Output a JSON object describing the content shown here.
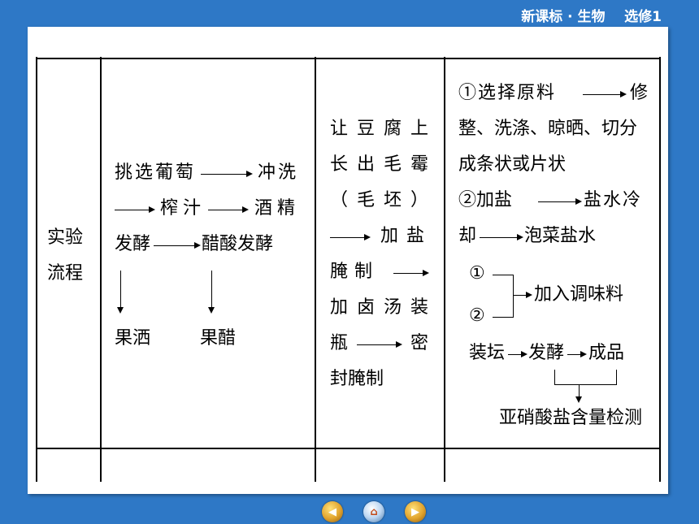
{
  "header": {
    "title": "新课标 · 生物    选修1"
  },
  "table": {
    "row_label": [
      "实验",
      "流程"
    ],
    "col1": {
      "line1": "挑选葡萄",
      "line1_end": "冲洗",
      "line2_mid": "榨汁",
      "line2_end": "酒精",
      "line3a": "发酵",
      "line3b": "醋酸发酵",
      "product1": "果洒",
      "product2": "果醋"
    },
    "col2": {
      "lines": [
        "让豆腐上",
        "长出毛霉",
        "（ 毛 坯 ）",
        "加盐",
        "腌制",
        "加卤汤装",
        "瓶",
        "密",
        "封腌制"
      ]
    },
    "col3": {
      "step1_a": "①选择原料",
      "step1_b": "修",
      "step1_c": "整、洗涤、晾晒、切分",
      "step1_d": "成条状或片状",
      "step2_a": "②加盐",
      "step2_b": "盐水冷",
      "step2_c": "却",
      "step2_d": "泡菜盐水",
      "d1": "①",
      "d2": "②",
      "add_seasoning": "加入调味料",
      "flow": [
        "装坛",
        "发酵",
        "成品"
      ],
      "detect": "亚硝酸盐含量检测"
    }
  },
  "nav": {
    "prev_icon": "prev-icon",
    "home_icon": "home-icon",
    "next_icon": "next-icon"
  }
}
